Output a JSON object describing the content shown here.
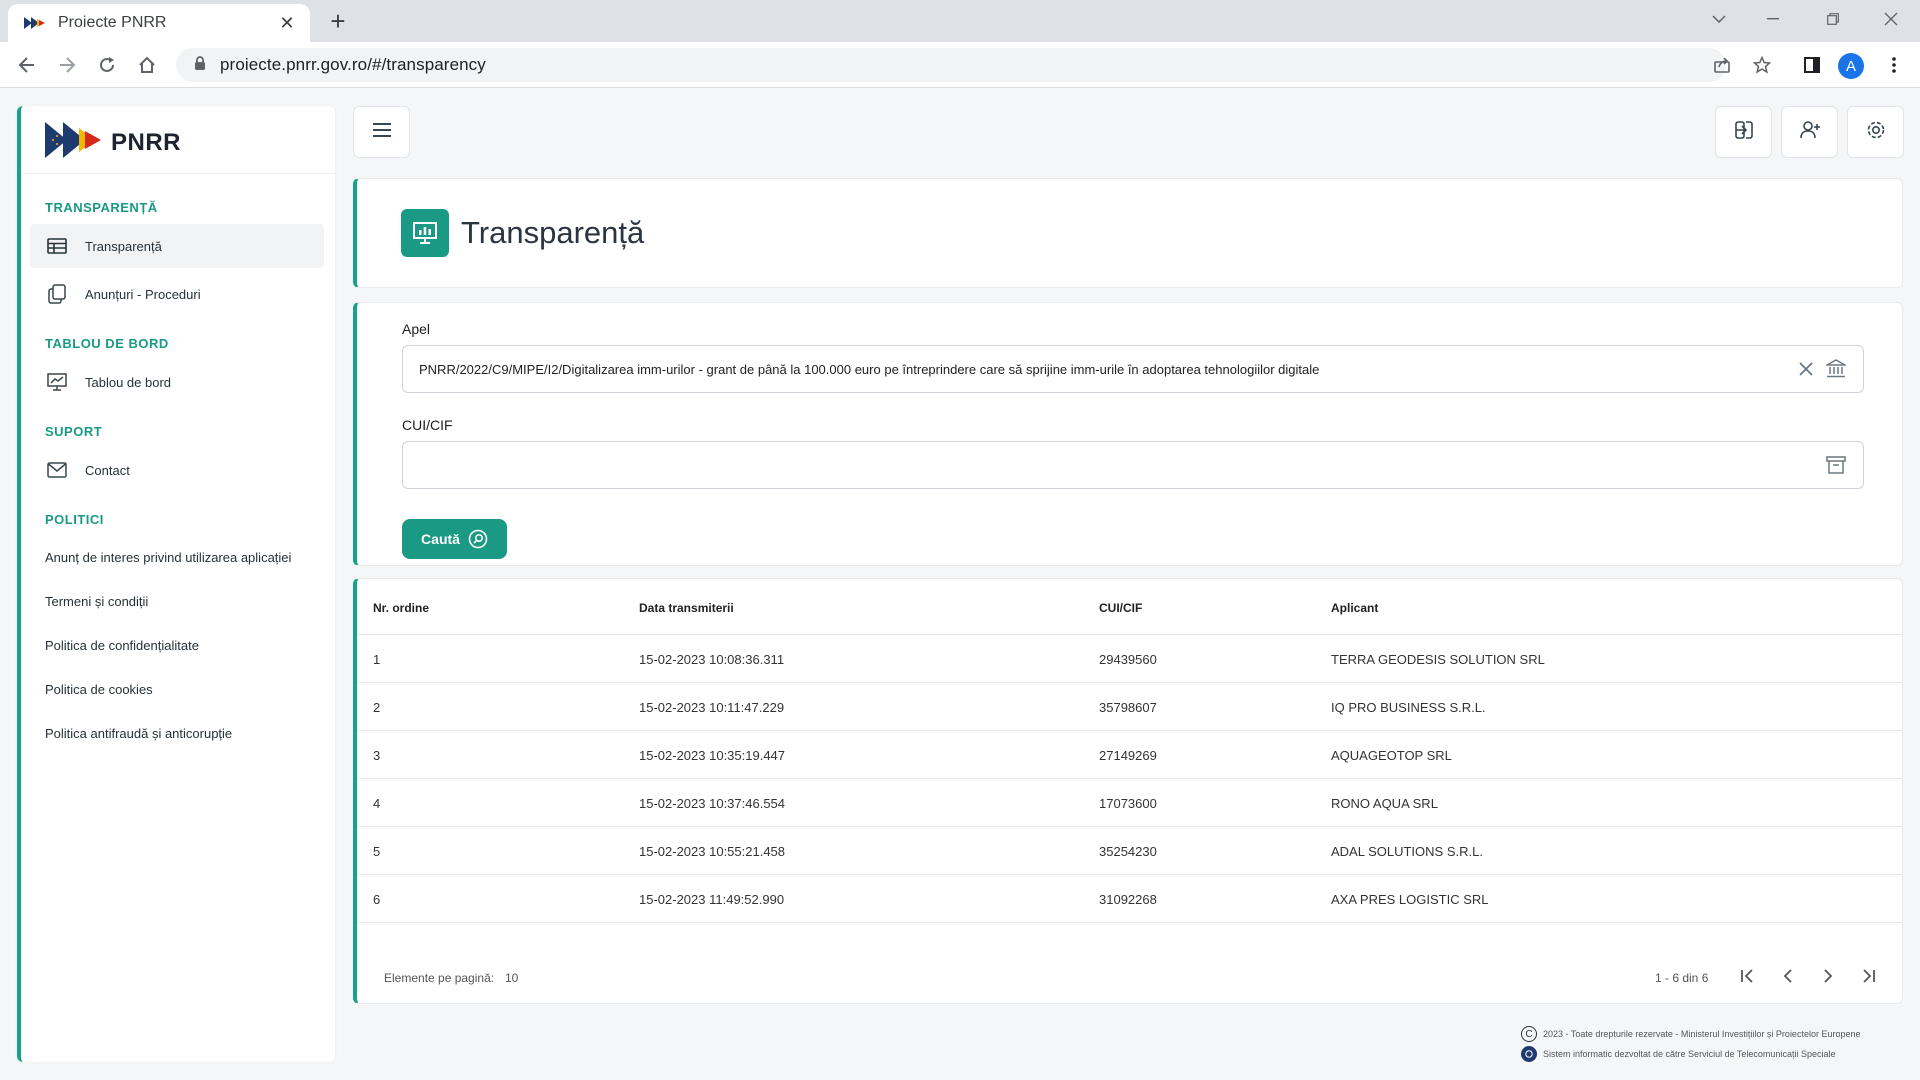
{
  "browser": {
    "tab_title": "Proiecte PNRR",
    "url": "proiecte.pnrr.gov.ro/#/transparency",
    "profile_initial": "A"
  },
  "brand": {
    "name": "PNRR"
  },
  "sidebar": {
    "sections": {
      "transparenta": "TRANSPARENȚĂ",
      "tablou": "TABLOU DE BORD",
      "suport": "SUPORT",
      "politici": "POLITICI"
    },
    "items": {
      "transparenta": "Transparență",
      "anunturi": "Anunțuri - Proceduri",
      "tablou": "Tablou de bord",
      "contact": "Contact"
    },
    "policies": [
      "Anunț de interes privind utilizarea aplicației",
      "Termeni și condiții",
      "Politica de confidențialitate",
      "Politica de cookies",
      "Politica antifraudă și anticorupție"
    ]
  },
  "page": {
    "title": "Transparență"
  },
  "form": {
    "apel_label": "Apel",
    "apel_value": "PNRR/2022/C9/MIPE/I2/Digitalizarea imm-urilor - grant de până la 100.000 euro pe întreprindere care  să sprijine imm-urile în adoptarea tehnologiilor digitale",
    "cui_label": "CUI/CIF",
    "cui_value": "",
    "search_label": "Caută"
  },
  "table": {
    "headers": [
      "Nr. ordine",
      "Data transmiterii",
      "CUI/CIF",
      "Aplicant"
    ],
    "rows": [
      [
        "1",
        "15-02-2023 10:08:36.311",
        "29439560",
        "TERRA GEODESIS SOLUTION SRL"
      ],
      [
        "2",
        "15-02-2023 10:11:47.229",
        "35798607",
        "IQ PRO BUSINESS S.R.L."
      ],
      [
        "3",
        "15-02-2023 10:35:19.447",
        "27149269",
        "AQUAGEOTOP SRL"
      ],
      [
        "4",
        "15-02-2023 10:37:46.554",
        "17073600",
        "RONO AQUA SRL"
      ],
      [
        "5",
        "15-02-2023 10:55:21.458",
        "35254230",
        "ADAL SOLUTIONS S.R.L."
      ],
      [
        "6",
        "15-02-2023 11:49:52.990",
        "31092268",
        "AXA PRES LOGISTIC SRL"
      ]
    ]
  },
  "pager": {
    "items_label": "Elemente pe pagină:",
    "page_size": "10",
    "range": "1 - 6 din 6"
  },
  "footer": {
    "line1": "2023 - Toate drepturile rezervate - Ministerul Investițiilor și Proiectelor Europene",
    "line2": "Sistem informatic dezvoltat de către Serviciul de Telecomunicații Speciale"
  },
  "colors": {
    "accent": "#1a9985",
    "sidebar_border": "#1aa18a"
  }
}
